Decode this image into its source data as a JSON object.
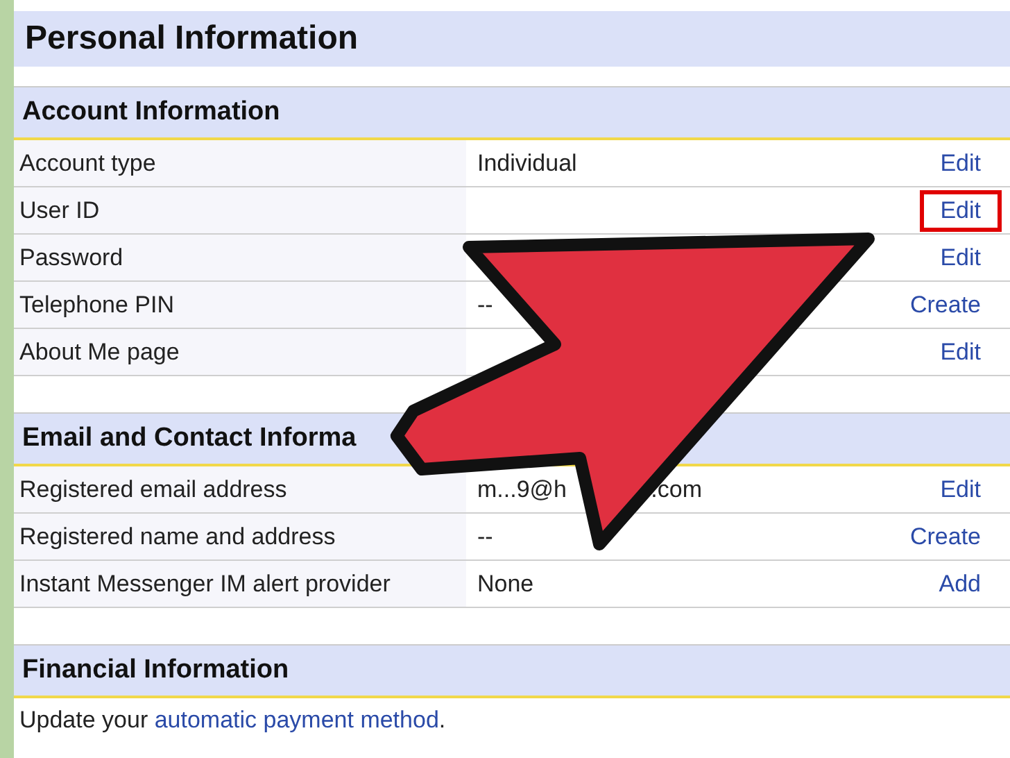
{
  "page_title": "Personal Information",
  "sections": [
    {
      "heading": "Account Information",
      "rows": [
        {
          "label": "Account type",
          "value": "Individual",
          "action": "Edit",
          "highlighted": false
        },
        {
          "label": "User ID",
          "action": "Edit",
          "highlighted": true
        },
        {
          "label": "Password",
          "action": "Edit",
          "highlighted": false
        },
        {
          "label": "Telephone PIN",
          "value": "--",
          "action": "Create",
          "highlighted": false
        },
        {
          "label": "About Me page",
          "action": "Edit",
          "highlighted": false
        }
      ]
    },
    {
      "heading": "Email and Contact Informa",
      "rows": [
        {
          "label": "Registered email address",
          "value": "m...9@h",
          "value_tail": ".com",
          "action": "Edit",
          "highlighted": false
        },
        {
          "label": "Registered name and address",
          "value": "--",
          "action": "Create",
          "highlighted": false
        },
        {
          "label": "Instant Messenger IM alert provider",
          "value": "None",
          "action": "Add",
          "highlighted": false
        }
      ]
    },
    {
      "heading": "Financial Information",
      "note": {
        "before": "Update your ",
        "link": "automatic payment method",
        "after": "."
      }
    }
  ]
}
